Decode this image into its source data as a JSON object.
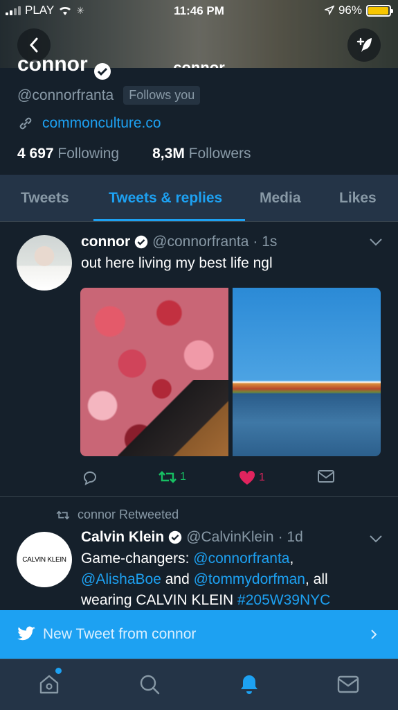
{
  "status_bar": {
    "carrier": "PLAY",
    "time": "11:46 PM",
    "battery": "96%"
  },
  "header": {
    "title": "connor"
  },
  "profile": {
    "name": "connor",
    "handle": "@connorfranta",
    "follows_badge": "Follows you",
    "link": "commonculture.co",
    "following_count": "4 697",
    "following_label": "Following",
    "followers_count": "8,3M",
    "followers_label": "Followers"
  },
  "tabs": [
    {
      "label": "Tweets"
    },
    {
      "label": "Tweets & replies"
    },
    {
      "label": "Media"
    },
    {
      "label": "Likes"
    }
  ],
  "tweet1": {
    "name": "connor",
    "handle": "@connorfranta",
    "time": "· 1s",
    "text": "out here living my best life ngl",
    "retweets": "1",
    "likes": "1"
  },
  "tweet2": {
    "retweeted_by": "connor Retweeted",
    "name": "Calvin Klein",
    "handle": "@CalvinKlein",
    "time": "· 1d",
    "avatar_text": "CALVIN KLEIN",
    "text_parts": [
      "Game-changers: ",
      "@connorfranta",
      ",",
      "@AlishaBoe",
      " and ",
      "@tommydorfman",
      ", all",
      "wearing CALVIN KLEIN ",
      "#205W39NYC"
    ]
  },
  "banner": {
    "text": "New Tweet from connor"
  },
  "colors": {
    "accent": "#1da1f2",
    "background": "#15202b",
    "retweet": "#17bf63",
    "like": "#e0245e"
  }
}
